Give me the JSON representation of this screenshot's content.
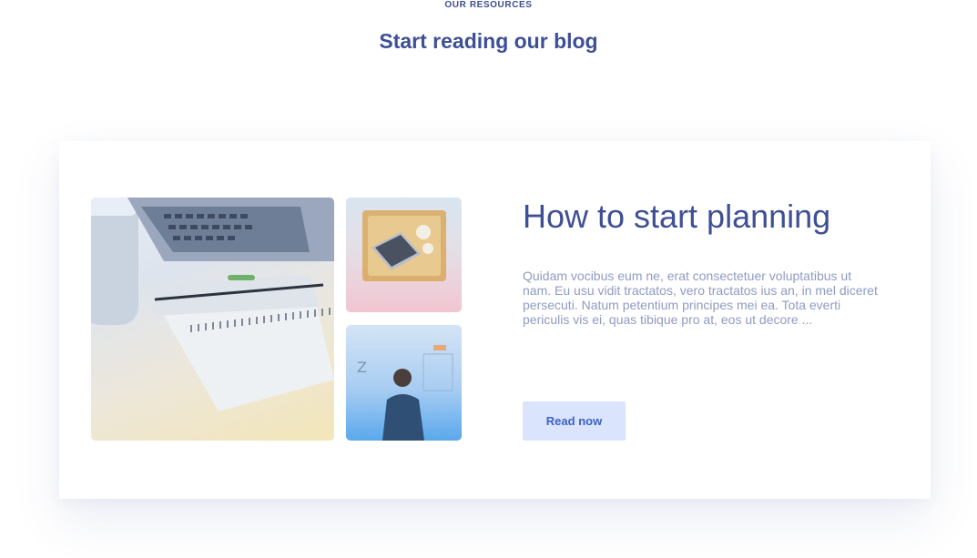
{
  "header": {
    "eyebrow": "OUR RESOURCES",
    "title": "Start reading our blog"
  },
  "post": {
    "title": "How to start planning",
    "excerpt": "Quidam vocibus eum ne, erat consectetuer voluptatibus ut nam. Eu usu vidit tractatos, vero tractatos ius an, in mel diceret persecuti. Natum petentium principes mei ea. Tota everti periculis vis ei, quas tibique pro at, eos ut decore ...",
    "button_label": "Read now",
    "images": [
      {
        "name": "laptop-notebook-desk-photo"
      },
      {
        "name": "laptop-on-tray-photo"
      },
      {
        "name": "person-at-whiteboard-photo"
      }
    ]
  },
  "colors": {
    "heading": "#3d4f96",
    "text_muted": "#8f9bc2",
    "button_bg": "#dbe4fd",
    "button_text": "#3a62c6"
  }
}
